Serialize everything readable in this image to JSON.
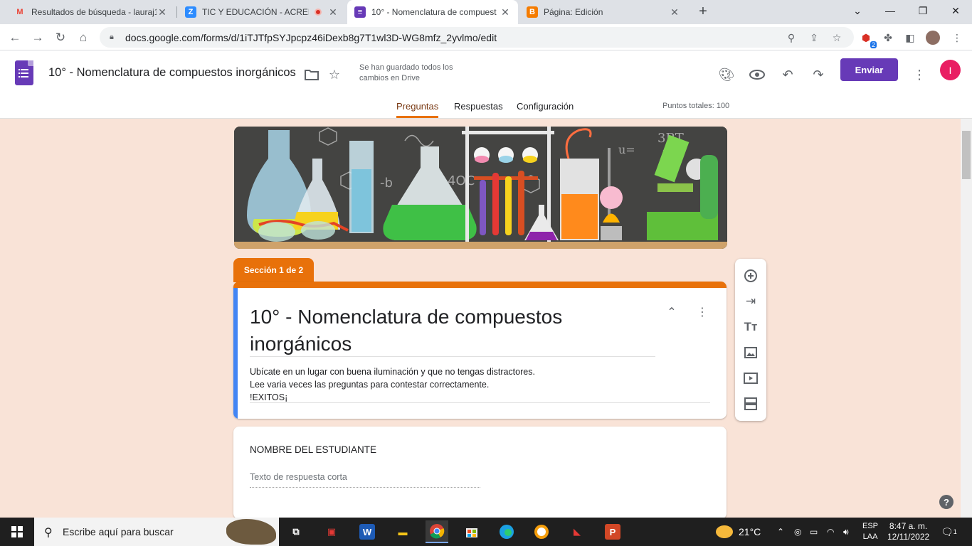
{
  "browser": {
    "tabs": [
      {
        "label": "Resultados de búsqueda - lauraj1",
        "favicon": "M",
        "favicon_color": "#ea4335"
      },
      {
        "label": "TIC Y EDUCACIÓN - ACREDIT",
        "favicon": "Z",
        "favicon_color": "#2d8cff"
      },
      {
        "label": "10° - Nomenclatura de compuest",
        "favicon": "≡",
        "favicon_color": "#673ab7"
      },
      {
        "label": "Página: Edición",
        "favicon": "B",
        "favicon_color": "#f57c00"
      }
    ],
    "url": "docs.google.com/forms/d/1iTJTfpSYJpcpz46iDexb8g7T1wl3D-WG8mfz_2yvlmo/edit",
    "extension_badge": "2"
  },
  "forms": {
    "doc_title": "10° - Nomenclatura de compuestos inorgánicos",
    "save_status": "Se han guardado todos los cambios en Drive",
    "send_label": "Enviar",
    "avatar_letter": "I",
    "tabs": [
      "Preguntas",
      "Respuestas",
      "Configuración"
    ],
    "total_points": "Puntos totales: 100",
    "section_tag": "Sección 1 de 2",
    "form_title": "10° - Nomenclatura de compuestos inorgánicos",
    "description": [
      "Ubícate en un lugar con buena iluminación y que no tengas distractores.",
      "Lee varia veces las preguntas para contestar correctamente.",
      "!EXITOS¡"
    ],
    "question_1": {
      "title": "NOMBRE DEL ESTUDIANTE",
      "placeholder": "Texto de respuesta corta"
    }
  },
  "taskbar": {
    "search_placeholder": "Escribe aquí para buscar",
    "weather": "21°C",
    "language": "ESP",
    "language_sub": "LAA",
    "time": "8:47 a. m.",
    "date": "12/11/2022",
    "notifications": "1"
  },
  "colors": {
    "accent": "#673ab7",
    "section": "#e8710a",
    "background": "#f9e3d7",
    "active_border": "#4285f4"
  }
}
